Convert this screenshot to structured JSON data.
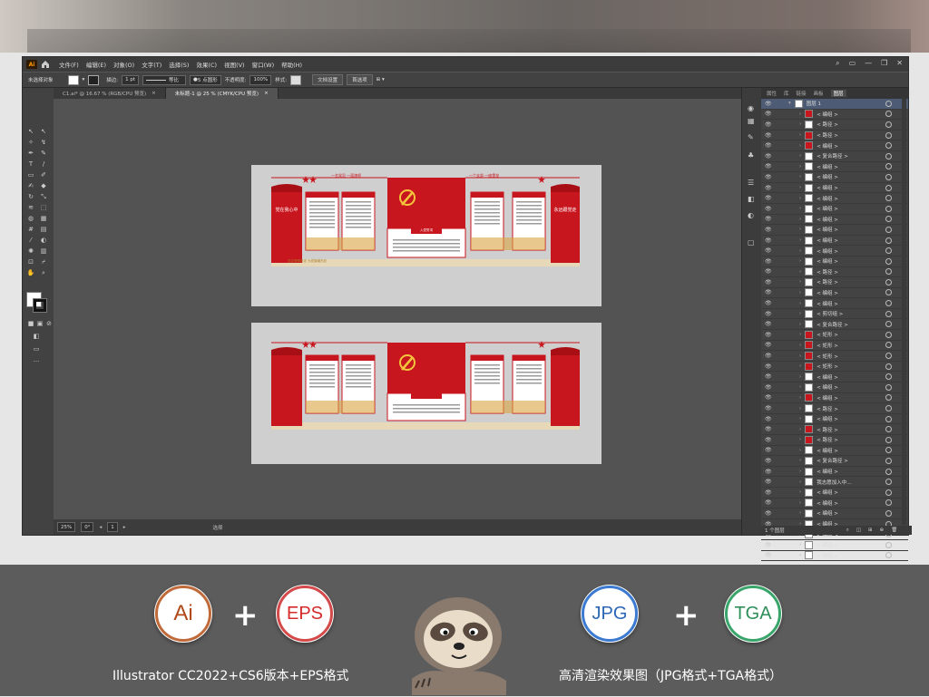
{
  "app": {
    "logo": "Ai",
    "menus": [
      "文件(F)",
      "编辑(E)",
      "对象(O)",
      "文字(T)",
      "选择(S)",
      "效果(C)",
      "视图(V)",
      "窗口(W)",
      "帮助(H)"
    ],
    "window_controls": [
      "—",
      "❐",
      "✕"
    ]
  },
  "control_bar": {
    "no_selection": "未选择对象",
    "stroke_label": "描边:",
    "stroke_value": "1 pt",
    "line_style": "等比",
    "brush": "5 点圆形",
    "opacity_label": "不透明度:",
    "opacity_value": "100%",
    "style_label": "样式:",
    "doc_setup_button": "文档设置",
    "prefs_button": "首选项"
  },
  "tabs": [
    {
      "label": "C1.ai* @ 16.67 % (RGB/CPU 预览)",
      "active": false
    },
    {
      "label": "未标题-1 @ 25 % (CMYK/CPU 预览)",
      "active": true
    }
  ],
  "status": {
    "zoom": "25%",
    "rotation": "0°",
    "artboard": "1",
    "tool": "选择"
  },
  "layers_panel": {
    "tabs": [
      "属性",
      "库",
      "链接",
      "画板",
      "图层"
    ],
    "active_tab": "图层",
    "footer_count": "1 个图层",
    "rows": [
      {
        "name": "图层 1",
        "thumb": "white"
      },
      {
        "name": "< 编组 >",
        "thumb": "red"
      },
      {
        "name": "< 路径 >",
        "thumb": "white"
      },
      {
        "name": "< 路径 >",
        "thumb": "red"
      },
      {
        "name": "< 编组 >",
        "thumb": "red"
      },
      {
        "name": "< 复合路径 >",
        "thumb": "white"
      },
      {
        "name": "< 编组 >",
        "thumb": "white"
      },
      {
        "name": "< 编组 >",
        "thumb": "white"
      },
      {
        "name": "< 编组 >",
        "thumb": "white"
      },
      {
        "name": "< 编组 >",
        "thumb": "white"
      },
      {
        "name": "< 编组 >",
        "thumb": "white"
      },
      {
        "name": "< 编组 >",
        "thumb": "white"
      },
      {
        "name": "< 编组 >",
        "thumb": "white"
      },
      {
        "name": "< 编组 >",
        "thumb": "white"
      },
      {
        "name": "< 编组 >",
        "thumb": "white"
      },
      {
        "name": "< 编组 >",
        "thumb": "white"
      },
      {
        "name": "< 路径 >",
        "thumb": "white"
      },
      {
        "name": "< 路径 >",
        "thumb": "white"
      },
      {
        "name": "< 编组 >",
        "thumb": "white"
      },
      {
        "name": "< 编组 >",
        "thumb": "white"
      },
      {
        "name": "< 剪切组 >",
        "thumb": "white"
      },
      {
        "name": "< 复合路径 >",
        "thumb": "white"
      },
      {
        "name": "< 矩形 >",
        "thumb": "red"
      },
      {
        "name": "< 矩形 >",
        "thumb": "red"
      },
      {
        "name": "< 矩形 >",
        "thumb": "red"
      },
      {
        "name": "< 矩形 >",
        "thumb": "red"
      },
      {
        "name": "< 编组 >",
        "thumb": "white"
      },
      {
        "name": "< 编组 >",
        "thumb": "white"
      },
      {
        "name": "< 编组 >",
        "thumb": "red"
      },
      {
        "name": "< 路径 >",
        "thumb": "white"
      },
      {
        "name": "< 编组 >",
        "thumb": "white"
      },
      {
        "name": "< 路径 >",
        "thumb": "red"
      },
      {
        "name": "< 路径 >",
        "thumb": "red"
      },
      {
        "name": "< 编组 >",
        "thumb": "white"
      },
      {
        "name": "< 复合路径 >",
        "thumb": "white"
      },
      {
        "name": "< 编组 >",
        "thumb": "white"
      },
      {
        "name": "我志愿加入中…",
        "thumb": "white"
      },
      {
        "name": "< 编组 >",
        "thumb": "white"
      },
      {
        "name": "< 编组 >",
        "thumb": "white"
      },
      {
        "name": "< 编组 >",
        "thumb": "white"
      },
      {
        "name": "< 编组 >",
        "thumb": "white"
      },
      {
        "name": "< 编组 >",
        "thumb": "white"
      },
      {
        "name": "< 编组 >",
        "thumb": "white"
      },
      {
        "name": "< 编组 >",
        "thumb": "white"
      }
    ]
  },
  "wall_design": {
    "left_slogan": "一名党员 一面旗帜",
    "right_slogan": "一个支部 一座堡垒",
    "left_side_title": "党在我心中",
    "right_side_title": "永远跟党走",
    "center_title": "入党誓词",
    "bottom_left": "坚定理想信念 为党旗增光彩",
    "colors": {
      "red": "#c8161e",
      "gold": "#d9a441",
      "beige": "#e7d9b8"
    }
  },
  "formats": {
    "badges": [
      {
        "label": "Ai",
        "color": "#b04a1c",
        "ring": "#c06a3a"
      },
      {
        "label": "EPS",
        "color": "#d42a2a",
        "ring": "#d44a4a"
      },
      {
        "label": "JPG",
        "color": "#2b66b5",
        "ring": "#3b7ad0"
      },
      {
        "label": "TGA",
        "color": "#2f8f5a",
        "ring": "#3aa56a"
      }
    ],
    "plus": "+",
    "left_caption": "Illustrator CC2022+CS6版本+EPS格式",
    "right_caption": "高清渲染效果图（JPG格式+TGA格式）"
  }
}
